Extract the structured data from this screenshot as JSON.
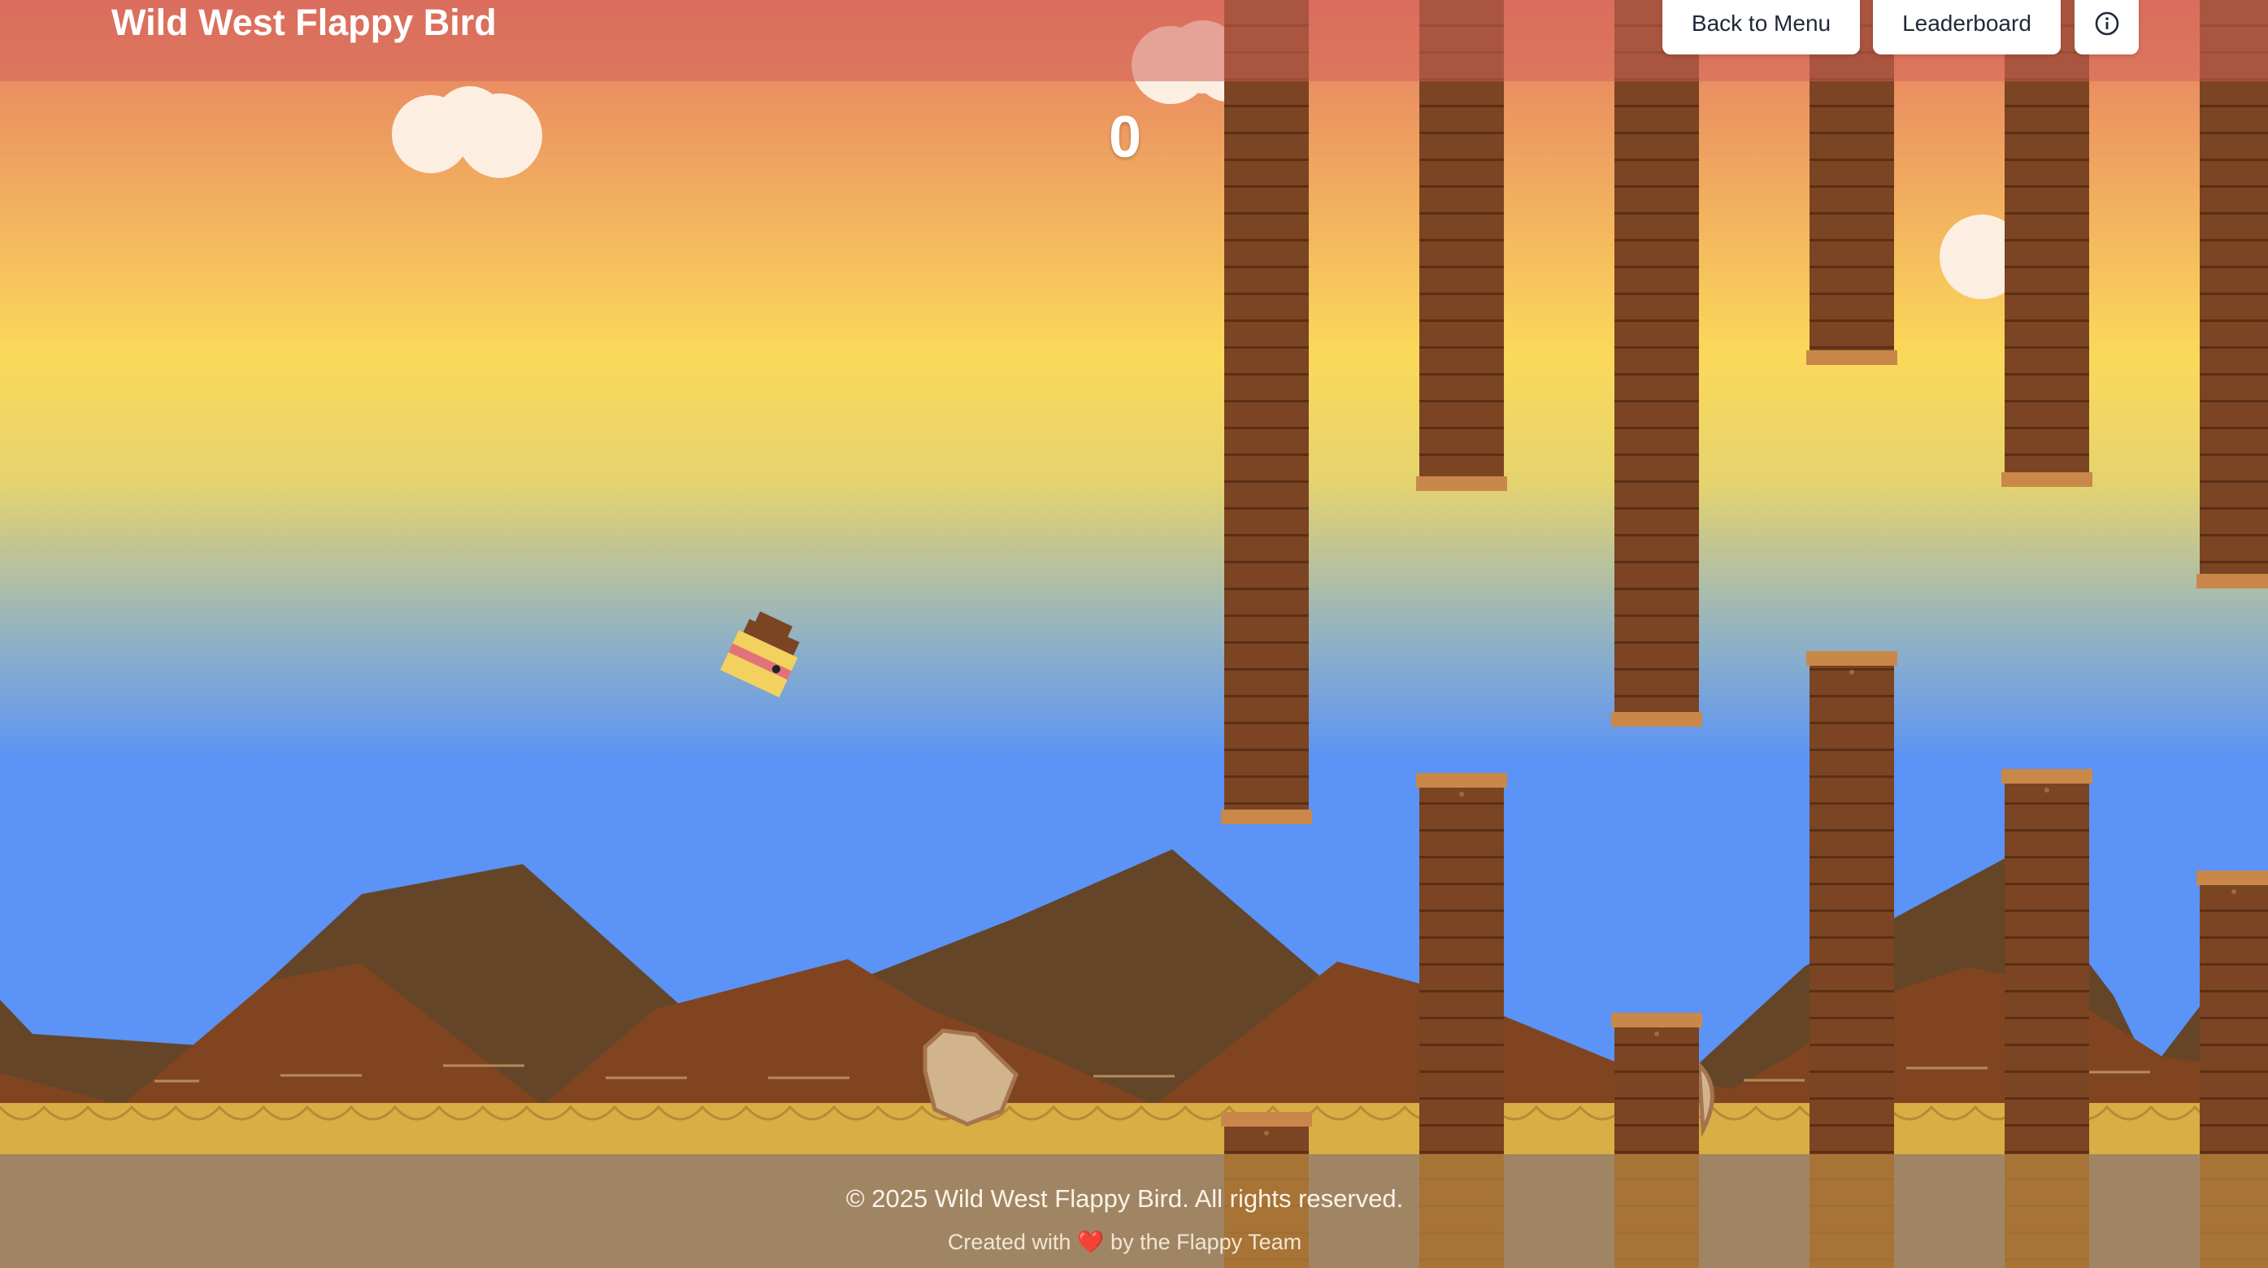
{
  "header": {
    "title": "Wild West Flappy Bird",
    "back_to_menu": "Back to Menu",
    "leaderboard": "Leaderboard",
    "info_icon": "info-circle-icon"
  },
  "game": {
    "score": "0"
  },
  "footer": {
    "copyright": "© 2025 Wild West Flappy Bird. All rights reserved.",
    "credit_prefix": "Created with",
    "credit_heart": "❤️",
    "credit_suffix": "by the Flappy Team"
  },
  "colors": {
    "sky_top": "#e57864",
    "sky_mid": "#fbd95a",
    "sky_bottom": "#5b93f6",
    "pipe": "#7b4422",
    "pipe_cap": "#c9884a",
    "mountain_far": "#654528",
    "mountain_near": "#804520",
    "ground": "#d8ae45",
    "bird_body": "#f3d15e",
    "bird_stripe": "#e0737a",
    "bird_hat": "#7b4422"
  }
}
